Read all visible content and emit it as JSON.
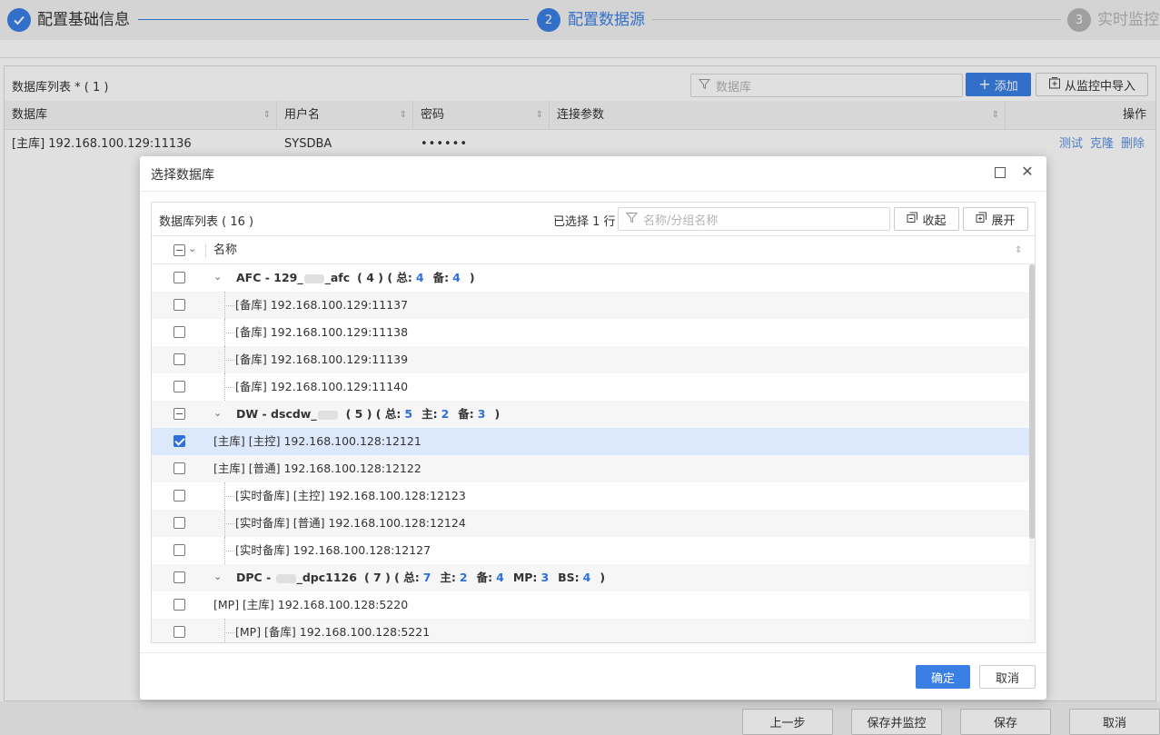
{
  "stepper": {
    "steps": [
      {
        "number": "✓",
        "label": "配置基础信息",
        "state": "done"
      },
      {
        "number": "2",
        "label": "配置数据源",
        "state": "active"
      },
      {
        "number": "3",
        "label": "实时监控",
        "state": "pending"
      }
    ],
    "colors": {
      "done": "#3a7fe4",
      "active": "#3a7fe4",
      "pending": "#b5b5b5",
      "active_text": "#3a7fe4",
      "pending_text": "#b5b5b5"
    }
  },
  "main": {
    "title": "数据库列表 * ( 1 )",
    "search_placeholder": "数据库",
    "add_label": "添加",
    "import_label": "从监控中导入",
    "columns": [
      "数据库",
      "用户名",
      "密码",
      "连接参数",
      "操作"
    ],
    "row": {
      "database": "[主库] 192.168.100.129:11136",
      "username": "SYSDBA",
      "password": "••••••",
      "params": "",
      "actions": [
        "测试",
        "克隆",
        "删除"
      ]
    }
  },
  "dialog": {
    "title": "选择数据库",
    "list_title": "数据库列表 ( 16 )",
    "selected_text": "已选择 1 行",
    "search_placeholder": "名称/分组名称",
    "collapse_label": "收起",
    "expand_label": "展开",
    "column_name": "名称",
    "groups": [
      {
        "check": "none",
        "prefix": "AFC - 129_",
        "suffix": "_afc",
        "count": "( 4 )",
        "stats": [
          {
            "k": "总:",
            "v": "4"
          },
          {
            "k": "备:",
            "v": "4"
          }
        ],
        "items": [
          {
            "text": "[备库] 192.168.100.129:11137",
            "indent": true,
            "check": "none"
          },
          {
            "text": "[备库] 192.168.100.129:11138",
            "indent": true,
            "check": "none"
          },
          {
            "text": "[备库] 192.168.100.129:11139",
            "indent": true,
            "check": "none"
          },
          {
            "text": "[备库] 192.168.100.129:11140",
            "indent": true,
            "check": "none"
          }
        ]
      },
      {
        "check": "partial",
        "prefix": "DW - dscdw_",
        "suffix": "",
        "count": "( 5 )",
        "stats": [
          {
            "k": "总:",
            "v": "5"
          },
          {
            "k": "主:",
            "v": "2"
          },
          {
            "k": "备:",
            "v": "3"
          }
        ],
        "items": [
          {
            "text": "[主库] [主控] 192.168.100.128:12121",
            "indent": false,
            "check": "checked"
          },
          {
            "text": "[主库] [普通] 192.168.100.128:12122",
            "indent": false,
            "check": "none"
          },
          {
            "text": "[实时备库] [主控] 192.168.100.128:12123",
            "indent": true,
            "check": "none"
          },
          {
            "text": "[实时备库] [普通] 192.168.100.128:12124",
            "indent": true,
            "check": "none"
          },
          {
            "text": "[实时备库] 192.168.100.128:12127",
            "indent": true,
            "check": "none"
          }
        ]
      },
      {
        "check": "none",
        "prefix": "DPC - ",
        "suffix": "_dpc1126",
        "count": "( 7 )",
        "stats": [
          {
            "k": "总:",
            "v": "7"
          },
          {
            "k": "主:",
            "v": "2"
          },
          {
            "k": "备:",
            "v": "4"
          },
          {
            "k": "MP:",
            "v": "3"
          },
          {
            "k": "BS:",
            "v": "4"
          }
        ],
        "items": [
          {
            "text": "[MP] [主库] 192.168.100.128:5220",
            "indent": false,
            "check": "none"
          },
          {
            "text": "[MP] [备库] 192.168.100.128:5221",
            "indent": true,
            "check": "none"
          }
        ]
      }
    ],
    "ok_label": "确定",
    "cancel_label": "取消"
  },
  "footer": {
    "buttons": [
      "上一步",
      "保存并监控",
      "保存",
      "取消"
    ]
  }
}
